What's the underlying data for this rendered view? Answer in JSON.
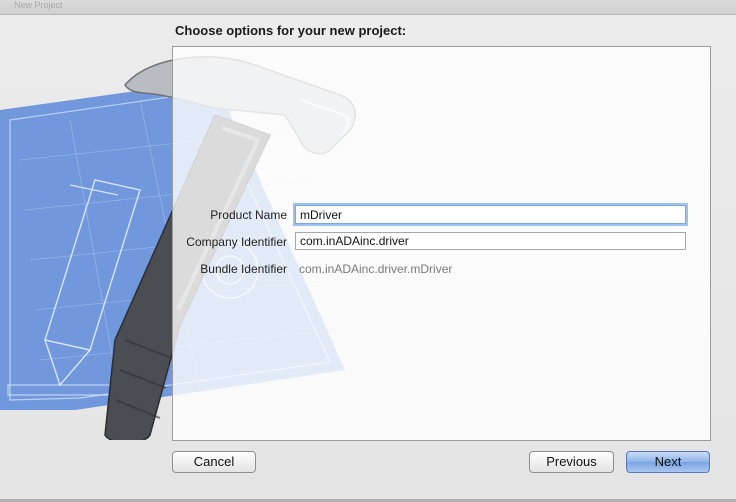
{
  "window": {
    "title": "New Project"
  },
  "heading": "Choose options for your new project:",
  "form": {
    "product_name": {
      "label": "Product Name",
      "value": "mDriver"
    },
    "company_identifier": {
      "label": "Company Identifier",
      "value": "com.inADAinc.driver"
    },
    "bundle_identifier": {
      "label": "Bundle Identifier",
      "value": "com.inADAinc.driver.mDriver"
    }
  },
  "buttons": {
    "cancel": "Cancel",
    "previous": "Previous",
    "next": "Next"
  },
  "colors": {
    "accent": "#7aa7e0",
    "blueprint": "#4f7fd6",
    "next_button": "#8fb3e8"
  },
  "icons": [
    "xcode-hammer-blueprint-icon"
  ]
}
